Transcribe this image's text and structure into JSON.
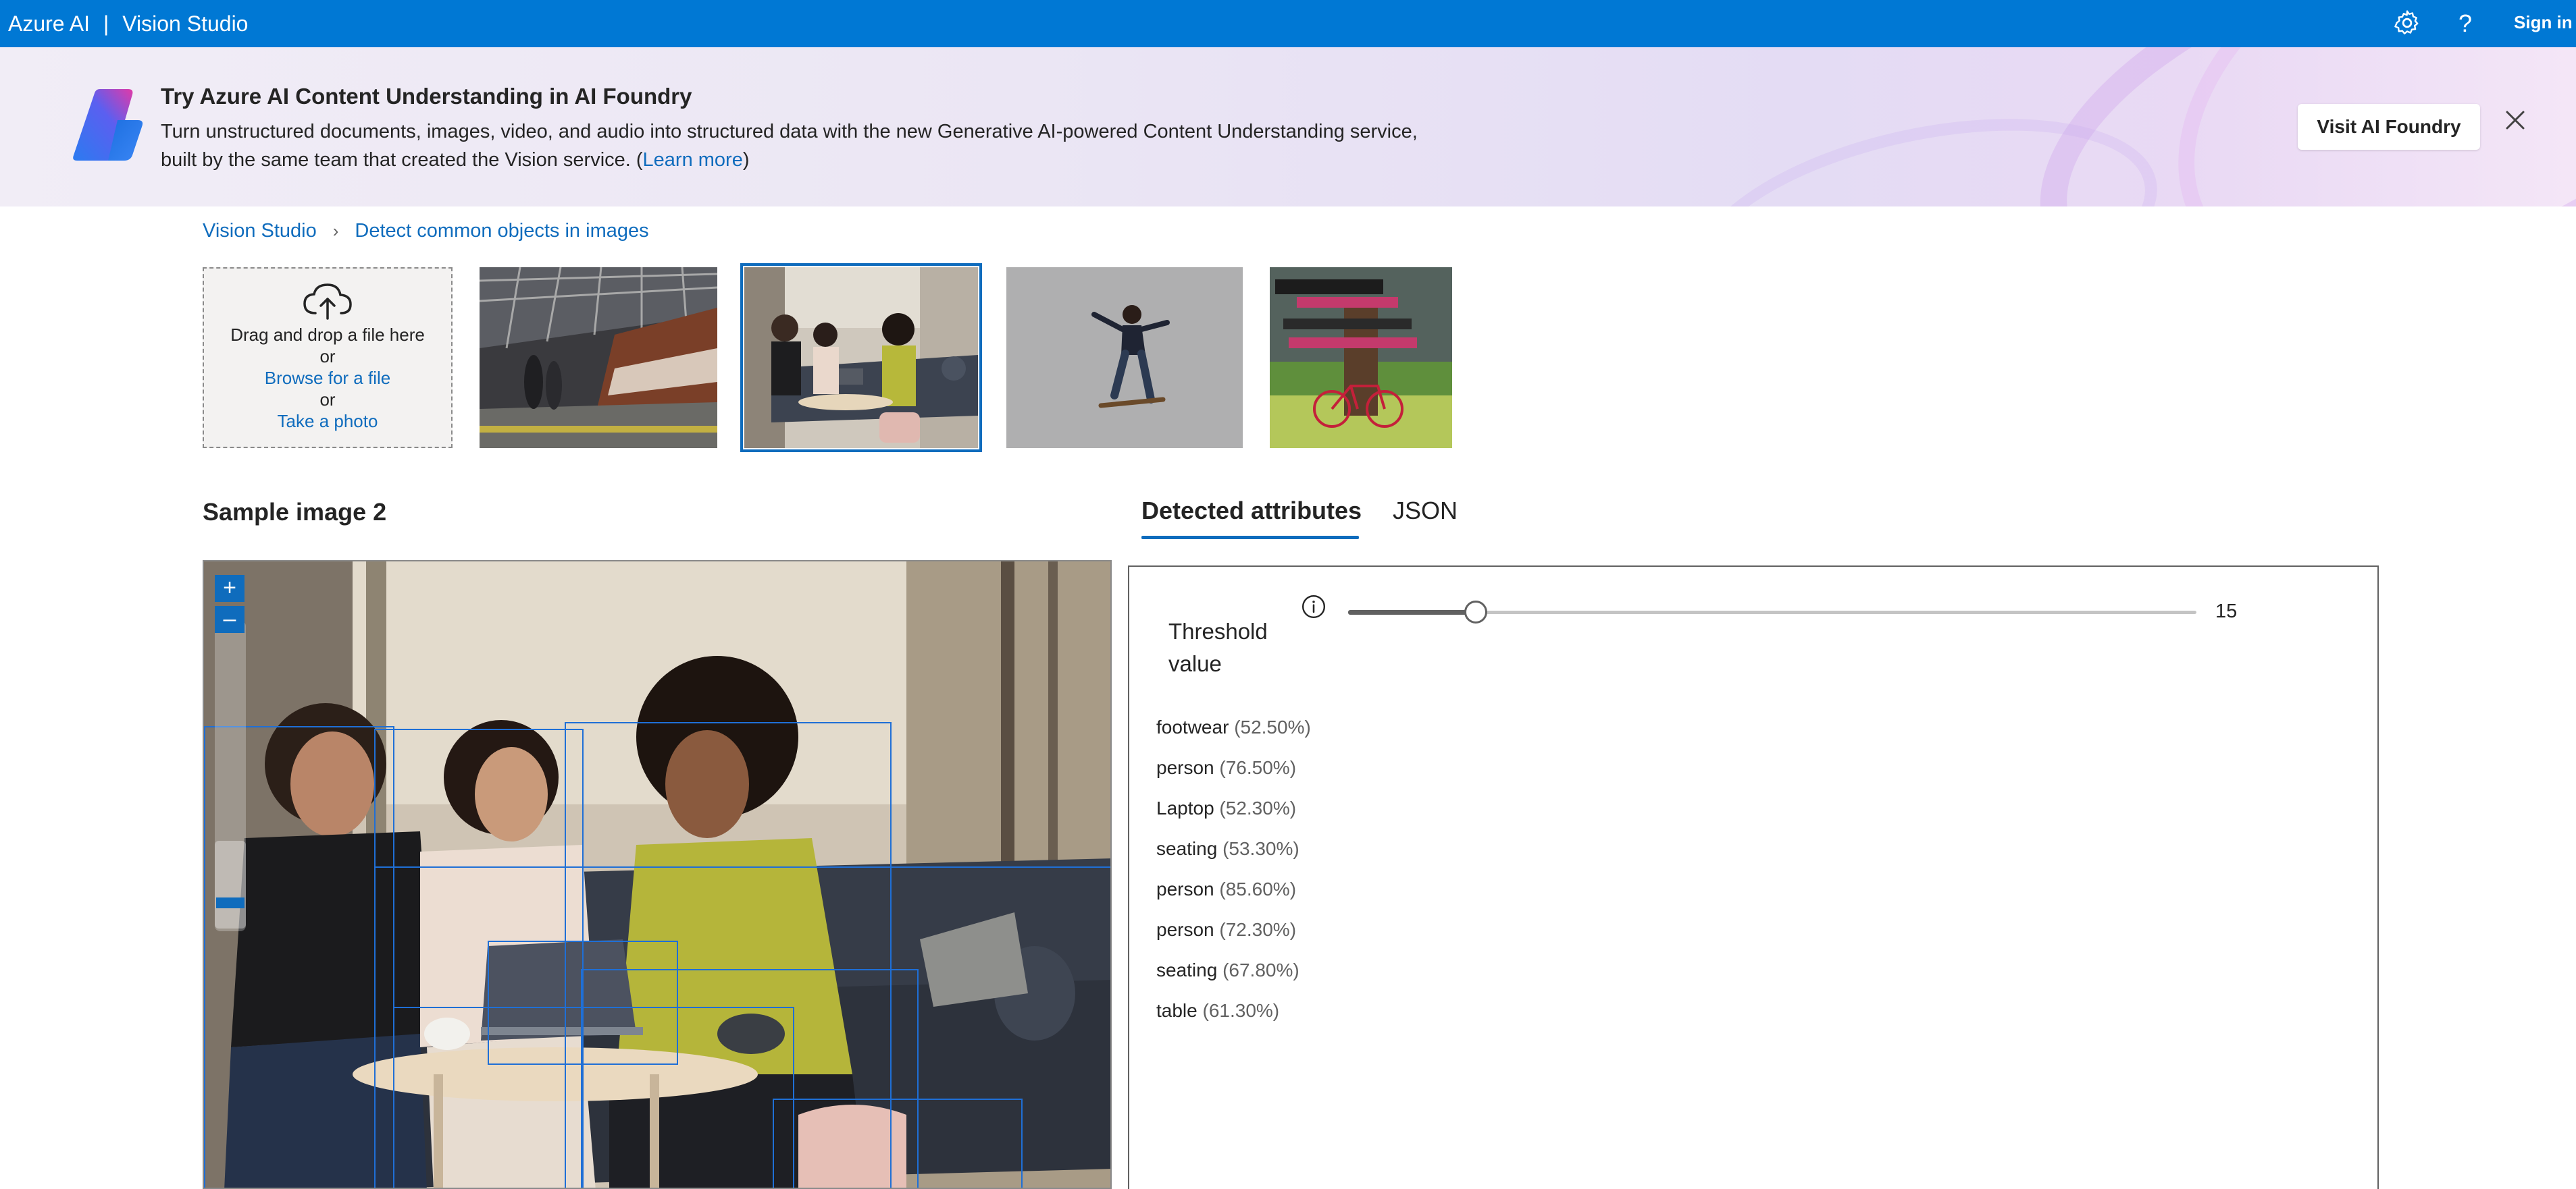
{
  "topbar": {
    "brand": "Azure AI",
    "separator": "|",
    "product": "Vision Studio",
    "settings_icon": "gear-icon",
    "help_icon": "?",
    "sign_in": "Sign in",
    "color": "#0078d4"
  },
  "banner": {
    "title": "Try Azure AI Content Understanding in AI Foundry",
    "description": "Turn unstructured documents, images, video, and audio into structured data with the new Generative AI-powered Content Understanding service, built by the same team that created the Vision service. (",
    "learn_more": "Learn more",
    "closing_paren": ")",
    "button": "Visit AI Foundry",
    "close_icon": "close-icon"
  },
  "breadcrumb": {
    "root": "Vision Studio",
    "chevron": "›",
    "current": "Detect common objects in images"
  },
  "upload": {
    "line1": "Drag and drop a file here",
    "or1": "or",
    "browse": "Browse for a file",
    "or2": "or",
    "photo": "Take a photo",
    "icon": "cloud-upload-icon"
  },
  "samples": {
    "selected_index": 2
  },
  "section": {
    "heading": "Sample image 2"
  },
  "tabs": [
    {
      "label": "Detected attributes",
      "active": true
    },
    {
      "label": "JSON",
      "active": false
    }
  ],
  "viewer": {
    "zoom_in": "+",
    "zoom_out": "–"
  },
  "threshold": {
    "label": "Threshold value",
    "value": "15",
    "value_fraction": 0.15,
    "info_icon": "info-icon"
  },
  "attributes": [
    {
      "name": "footwear",
      "confidence": "(52.50%)"
    },
    {
      "name": "person",
      "confidence": "(76.50%)"
    },
    {
      "name": "Laptop",
      "confidence": "(52.30%)"
    },
    {
      "name": "seating",
      "confidence": "(53.30%)"
    },
    {
      "name": "person",
      "confidence": "(85.60%)"
    },
    {
      "name": "person",
      "confidence": "(72.30%)"
    },
    {
      "name": "seating",
      "confidence": "(67.80%)"
    },
    {
      "name": "table",
      "confidence": "(61.30%)"
    }
  ]
}
